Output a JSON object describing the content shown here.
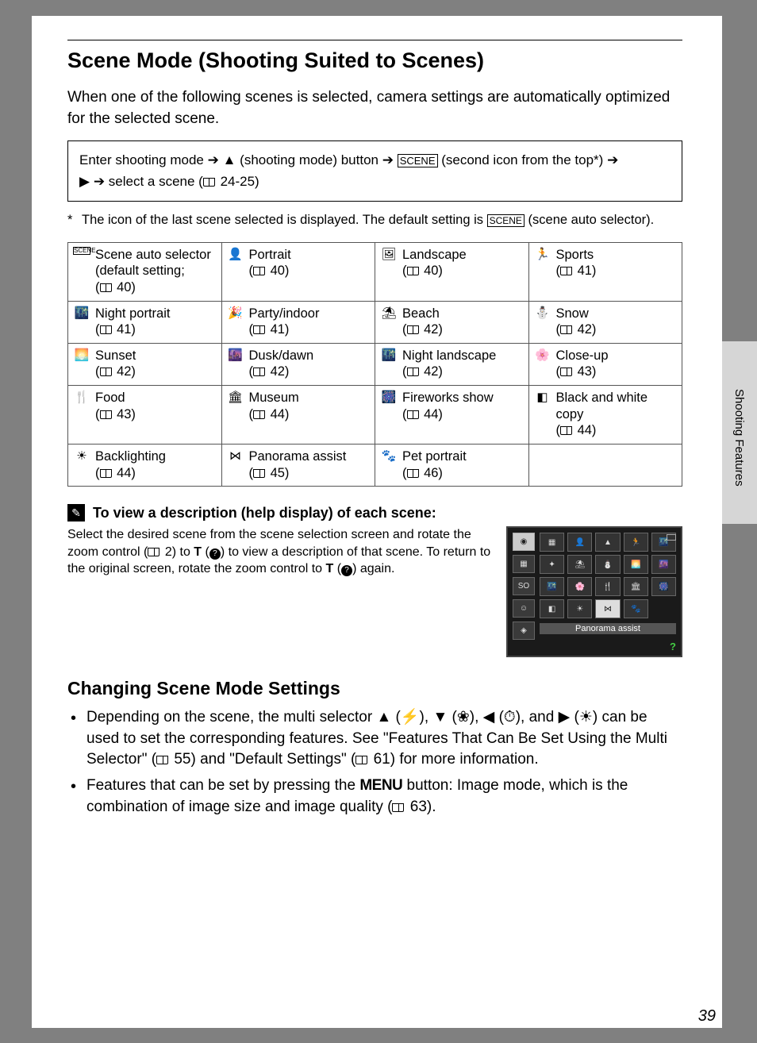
{
  "title": "Scene Mode (Shooting Suited to Scenes)",
  "intro": "When one of the following scenes is selected, camera settings are automatically optimized for the selected scene.",
  "nav_box": {
    "line1_a": "Enter shooting mode",
    "line1_b": "(shooting mode) button",
    "line1_c": "(second icon from the top*)",
    "line2_a": "select a scene (",
    "line2_b": "24-25)"
  },
  "footnote": {
    "marker": "*",
    "text_a": "The icon of the last scene selected is displayed. The default setting is",
    "text_b": "(scene auto selector)."
  },
  "scene_table": {
    "rows": [
      [
        {
          "icon": "SCENE",
          "name": "Scene auto selector",
          "suffix": "(default setting;",
          "page": "40)"
        },
        {
          "icon": "👤",
          "name": "Portrait",
          "page": "40)"
        },
        {
          "icon": "🖼",
          "name": "Landscape",
          "page": "40)"
        },
        {
          "icon": "🏃",
          "name": "Sports",
          "page": "41)"
        }
      ],
      [
        {
          "icon": "🌃",
          "name": "Night portrait",
          "page": "41)"
        },
        {
          "icon": "🎉",
          "name": "Party/indoor",
          "page": "41)"
        },
        {
          "icon": "⛱",
          "name": "Beach",
          "page": "42)"
        },
        {
          "icon": "⛄",
          "name": "Snow",
          "page": "42)"
        }
      ],
      [
        {
          "icon": "🌅",
          "name": "Sunset",
          "page": "42)"
        },
        {
          "icon": "🌆",
          "name": "Dusk/dawn",
          "page": "42)"
        },
        {
          "icon": "🌃",
          "name": "Night landscape",
          "page": "42)"
        },
        {
          "icon": "🌸",
          "name": "Close-up",
          "page": "43)"
        }
      ],
      [
        {
          "icon": "🍴",
          "name": "Food",
          "page": "43)"
        },
        {
          "icon": "🏛",
          "name": "Museum",
          "page": "44)"
        },
        {
          "icon": "🎆",
          "name": "Fireworks show",
          "page": "44)"
        },
        {
          "icon": "◧",
          "name": "Black and white copy",
          "page": "44)"
        }
      ],
      [
        {
          "icon": "☀",
          "name": "Backlighting",
          "page": "44)"
        },
        {
          "icon": "⋈",
          "name": "Panorama assist",
          "page": "45)"
        },
        {
          "icon": "🐾",
          "name": "Pet portrait",
          "page": "46)"
        },
        null
      ]
    ]
  },
  "help_section": {
    "heading": "To view a description (help display) of each scene:",
    "body_a": "Select the desired scene from the scene selection screen and rotate the zoom control (",
    "body_b": "2) to ",
    "body_c": ") to view a description of that scene. To return to the original screen, rotate the zoom control to ",
    "body_d": ") again."
  },
  "lcd": {
    "label": "Panorama assist",
    "side_mode": "SO"
  },
  "subheading": "Changing Scene Mode Settings",
  "bullets": [
    {
      "a": "Depending on the scene, the multi selector ",
      "b": "), ",
      "c": "), ",
      "d": "), and ",
      "e": ") can be used to set the corresponding features. See \"Features That Can Be Set Using the Multi Selector\" (",
      "f": "55) and \"Default Settings\" (",
      "g": "61) for more information."
    },
    {
      "a": "Features that can be set by pressing the ",
      "menu": "MENU",
      "b": " button: Image mode, which is the combination of image size and image quality (",
      "c": "63)."
    }
  ],
  "side_tab_label": "Shooting Features",
  "page_number": "39"
}
